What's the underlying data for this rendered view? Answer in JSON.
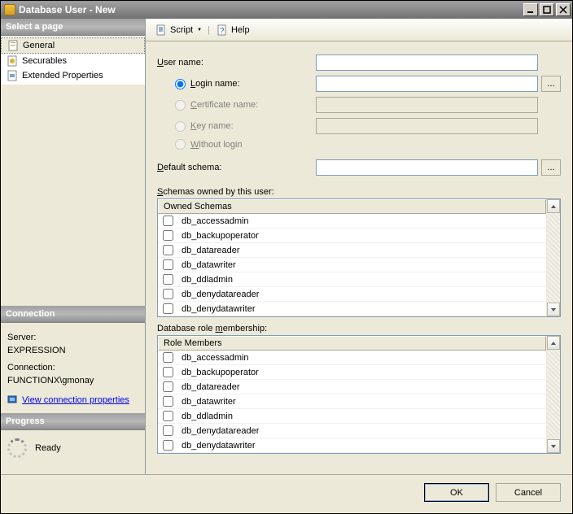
{
  "window": {
    "title": "Database User - New"
  },
  "sidebar": {
    "selectHeader": "Select a page",
    "pages": [
      "General",
      "Securables",
      "Extended Properties"
    ],
    "connectionHeader": "Connection",
    "serverLabel": "Server:",
    "serverValue": "EXPRESSION",
    "connLabel": "Connection:",
    "connValue": "FUNCTIONX\\gmonay",
    "viewConnProps": "View connection properties",
    "progressHeader": "Progress",
    "progressStatus": "Ready"
  },
  "toolbar": {
    "script": "Script",
    "help": "Help"
  },
  "form": {
    "userName": "User name:",
    "loginName": "Login name:",
    "certName": "Certificate name:",
    "keyName": "Key name:",
    "withoutLogin": "Without login",
    "defaultSchema": "Default schema:",
    "values": {
      "userName": "",
      "loginName": "",
      "defaultSchema": ""
    }
  },
  "owned": {
    "label": "Schemas owned by this user:",
    "header": "Owned Schemas",
    "items": [
      "db_accessadmin",
      "db_backupoperator",
      "db_datareader",
      "db_datawriter",
      "db_ddladmin",
      "db_denydatareader",
      "db_denydatawriter"
    ]
  },
  "roles": {
    "label": "Database role membership:",
    "header": "Role Members",
    "items": [
      "db_accessadmin",
      "db_backupoperator",
      "db_datareader",
      "db_datawriter",
      "db_ddladmin",
      "db_denydatareader",
      "db_denydatawriter"
    ]
  },
  "buttons": {
    "ok": "OK",
    "cancel": "Cancel"
  }
}
